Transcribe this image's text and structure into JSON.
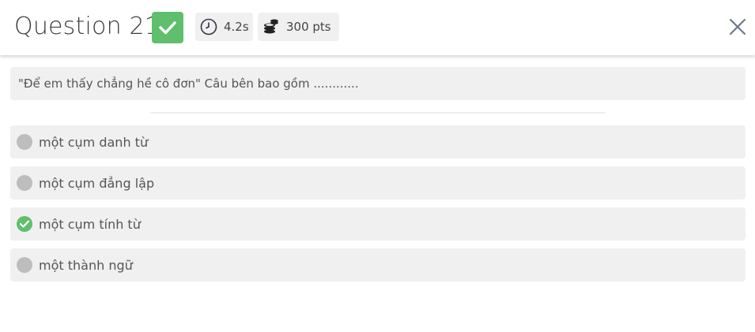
{
  "header": {
    "title": "Question 21",
    "time": "4.2s",
    "points": "300 pts"
  },
  "question": {
    "text": "\"Để em thấy chẳng hề cô đơn\" Câu bên bao gồm ............"
  },
  "options": [
    {
      "label": "một cụm danh từ",
      "correct": false
    },
    {
      "label": "một cụm đẳng lập",
      "correct": false
    },
    {
      "label": "một cụm tính từ",
      "correct": true
    },
    {
      "label": "một thành ngữ",
      "correct": false
    }
  ],
  "colors": {
    "correct_green": "#5fbf6c",
    "neutral_dot": "#bdbdbd",
    "panel_bg": "#f0f0f0"
  },
  "icons": {
    "status": "check-icon",
    "time": "clock-icon",
    "points": "coins-icon",
    "close": "close-icon"
  }
}
